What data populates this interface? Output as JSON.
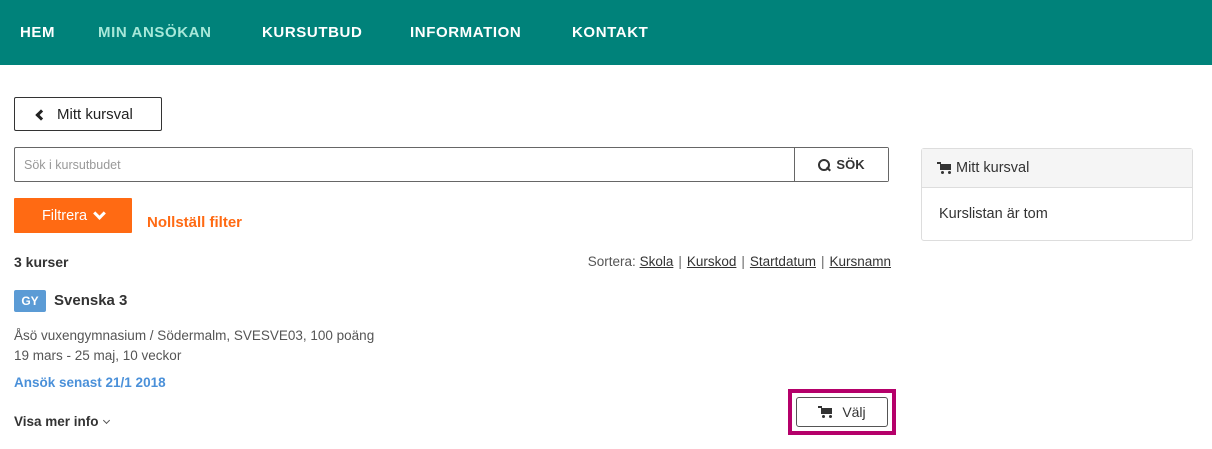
{
  "nav": {
    "items": [
      {
        "label": "HEM",
        "active": false
      },
      {
        "label": "MIN ANSÖKAN",
        "active": true
      },
      {
        "label": "KURSUTBUD",
        "active": false
      },
      {
        "label": "INFORMATION",
        "active": false
      },
      {
        "label": "KONTAKT",
        "active": false
      }
    ],
    "color": "#00827a"
  },
  "back_button": {
    "label": "Mitt kursval",
    "icon": "chevron-left-icon"
  },
  "search": {
    "placeholder": "Sök i kursutbudet",
    "value": "",
    "button_label": "SÖK"
  },
  "filter": {
    "button_label": "Filtrera",
    "reset_label": "Nollställ filter",
    "accent": "#ff6a13"
  },
  "results": {
    "count_label": "3 kurser",
    "sort_label": "Sortera:",
    "sort_options": [
      "Skola",
      "Kurskod",
      "Startdatum",
      "Kursnamn"
    ]
  },
  "course": {
    "badge": "GY",
    "title": "Svenska 3",
    "info": "Åsö vuxengymnasium / Södermalm, SVESVE03, 100 poäng",
    "dates": "19 mars - 25 maj, 10 veckor",
    "deadline": "Ansök senast 21/1 2018",
    "more_info": "Visa mer info",
    "choose_label": "Välj",
    "highlight_color": "#b5006a"
  },
  "sidebar": {
    "title": "Mitt kursval",
    "empty_text": "Kurslistan är tom"
  }
}
